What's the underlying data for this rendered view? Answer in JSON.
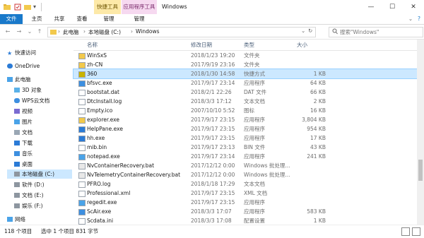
{
  "titlebar": {
    "context_tab_1": "快捷工具",
    "context_tab_2": "应用程序工具",
    "window_title": "Windows",
    "minimize": "—",
    "maximize": "☐",
    "close": "✕"
  },
  "ribbon": {
    "tabs": [
      "文件",
      "主页",
      "共享",
      "查看"
    ],
    "context_labels": [
      "管理",
      "管理"
    ]
  },
  "address": {
    "path": [
      "此电脑",
      "本地磁盘 (C:)",
      "Windows"
    ],
    "search_placeholder": "搜索\"Windows\""
  },
  "nav": {
    "items": [
      {
        "label": "快速访问",
        "icon": "star-icon"
      },
      {
        "label": "OneDrive",
        "icon": "cloud-icon"
      },
      {
        "label": "此电脑",
        "icon": "computer-icon"
      },
      {
        "label": "3D 对象",
        "icon": "cube-icon"
      },
      {
        "label": "WPS云文档",
        "icon": "cloud-doc-icon"
      },
      {
        "label": "视频",
        "icon": "video-icon"
      },
      {
        "label": "图片",
        "icon": "picture-icon"
      },
      {
        "label": "文档",
        "icon": "document-icon"
      },
      {
        "label": "下载",
        "icon": "download-icon"
      },
      {
        "label": "音乐",
        "icon": "music-icon"
      },
      {
        "label": "桌面",
        "icon": "desktop-icon"
      },
      {
        "label": "本地磁盘 (C:)",
        "icon": "drive-icon"
      },
      {
        "label": "软件 (D:)",
        "icon": "drive-icon"
      },
      {
        "label": "文档 (E:)",
        "icon": "drive-icon"
      },
      {
        "label": "娱乐 (F:)",
        "icon": "drive-icon"
      },
      {
        "label": "网络",
        "icon": "network-icon"
      }
    ]
  },
  "columns": [
    "名称",
    "修改日期",
    "类型",
    "大小"
  ],
  "files": [
    {
      "name": "WinSxS",
      "date": "2018/1/23 19:20",
      "type": "文件夹",
      "size": "",
      "icon": "folder-icon"
    },
    {
      "name": "zh-CN",
      "date": "2017/9/19 23:16",
      "type": "文件夹",
      "size": "",
      "icon": "folder-icon"
    },
    {
      "name": "360",
      "date": "2018/1/30 14:58",
      "type": "快捷方式",
      "size": "1 KB",
      "icon": "shortcut-icon"
    },
    {
      "name": "bfsvc.exe",
      "date": "2017/9/17 23:14",
      "type": "应用程序",
      "size": "64 KB",
      "icon": "exe-icon"
    },
    {
      "name": "bootstat.dat",
      "date": "2018/2/1 22:26",
      "type": "DAT 文件",
      "size": "66 KB",
      "icon": "file-icon"
    },
    {
      "name": "DtcInstall.log",
      "date": "2018/3/3 17:12",
      "type": "文本文档",
      "size": "2 KB",
      "icon": "text-file-icon"
    },
    {
      "name": "Empty.ico",
      "date": "2007/10/10 5:52",
      "type": "图标",
      "size": "16 KB",
      "icon": "file-icon"
    },
    {
      "name": "explorer.exe",
      "date": "2017/9/17 23:15",
      "type": "应用程序",
      "size": "3,804 KB",
      "icon": "explorer-icon"
    },
    {
      "name": "HelpPane.exe",
      "date": "2017/9/17 23:15",
      "type": "应用程序",
      "size": "954 KB",
      "icon": "help-icon"
    },
    {
      "name": "hh.exe",
      "date": "2017/9/17 23:15",
      "type": "应用程序",
      "size": "17 KB",
      "icon": "help-icon"
    },
    {
      "name": "mib.bin",
      "date": "2017/9/17 23:13",
      "type": "BIN 文件",
      "size": "43 KB",
      "icon": "file-icon"
    },
    {
      "name": "notepad.exe",
      "date": "2017/9/17 23:14",
      "type": "应用程序",
      "size": "241 KB",
      "icon": "notepad-icon"
    },
    {
      "name": "NvContainerRecovery.bat",
      "date": "2017/12/12 0:00",
      "type": "Windows 批处理...",
      "size": "",
      "icon": "bat-icon"
    },
    {
      "name": "NvTelemetryContainerRecovery.bat",
      "date": "2017/12/12 0:00",
      "type": "Windows 批处理...",
      "size": "",
      "icon": "bat-icon"
    },
    {
      "name": "PFRO.log",
      "date": "2018/1/18 17:29",
      "type": "文本文档",
      "size": "",
      "icon": "text-file-icon"
    },
    {
      "name": "Professional.xml",
      "date": "2017/9/17 23:15",
      "type": "XML 文档",
      "size": "",
      "icon": "file-icon"
    },
    {
      "name": "regedit.exe",
      "date": "2017/9/17 23:15",
      "type": "应用程序",
      "size": "",
      "icon": "regedit-icon"
    },
    {
      "name": "ScAir.exe",
      "date": "2018/3/3 17:07",
      "type": "应用程序",
      "size": "583 KB",
      "icon": "exe-icon"
    },
    {
      "name": "Scdata.ini",
      "date": "2018/3/3 17:08",
      "type": "配置设置",
      "size": "1 KB",
      "icon": "file-icon"
    }
  ],
  "selected_index": 2,
  "status": {
    "count": "118 个项目",
    "selection": "选中 1 个项目  831 字节"
  },
  "colors": {
    "accent": "#1979ca",
    "selection": "#cce8ff",
    "folder": "#f2c94c"
  }
}
